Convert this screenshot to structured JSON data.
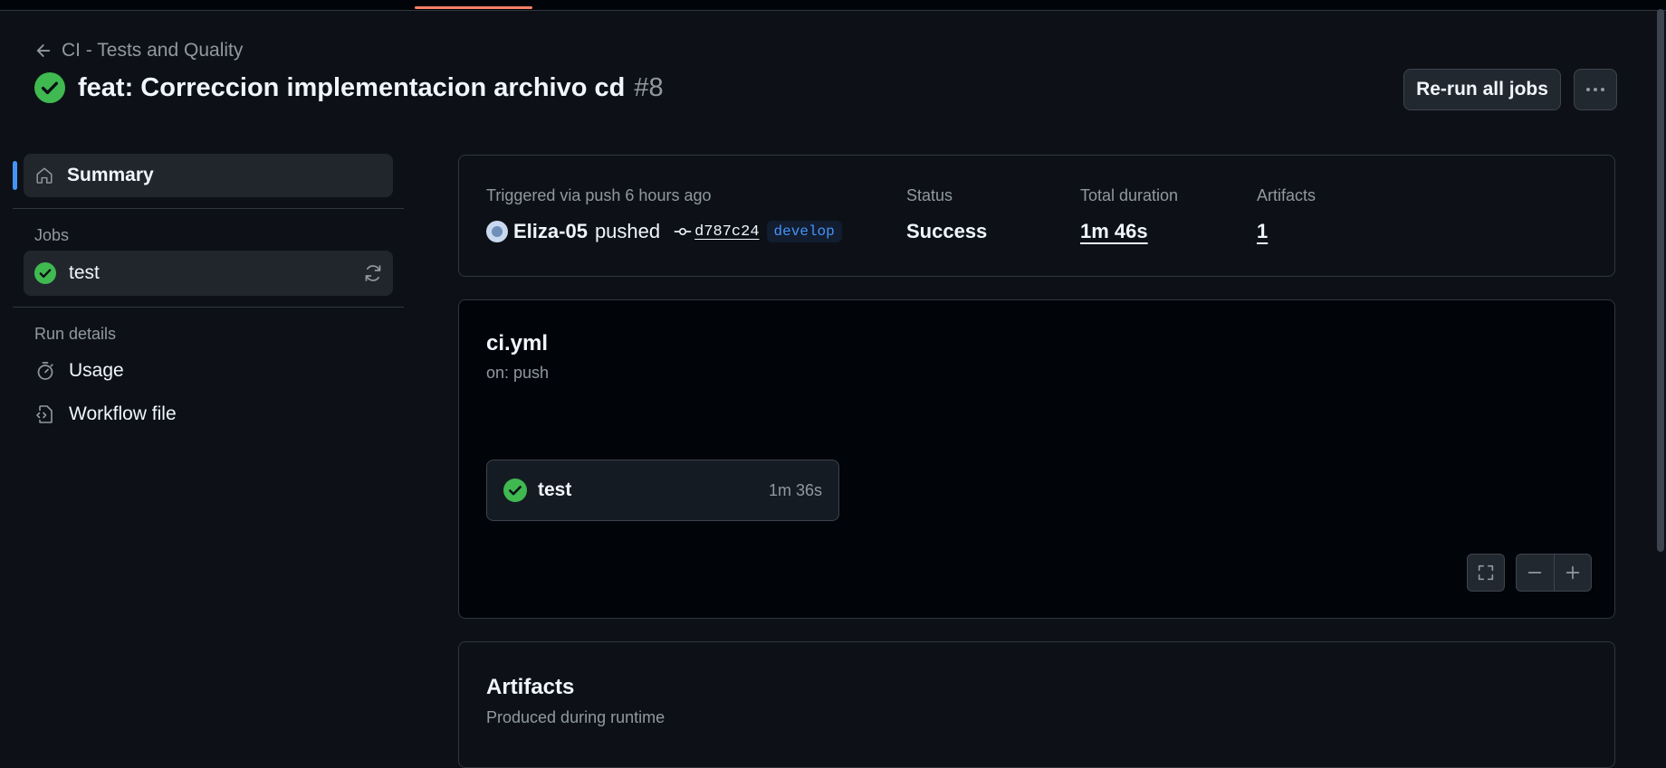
{
  "header": {
    "back_label": "CI - Tests and Quality",
    "title": "feat: Correccion implementacion archivo cd",
    "run_number": "#8",
    "rerun_label": "Re-run all jobs",
    "more_icon": "kebab-horizontal-icon"
  },
  "sidebar": {
    "summary_label": "Summary",
    "jobs_heading": "Jobs",
    "jobs": [
      {
        "label": "test",
        "status": "success"
      }
    ],
    "run_details_heading": "Run details",
    "run_details": [
      {
        "label": "Usage",
        "icon": "stopwatch-icon"
      },
      {
        "label": "Workflow file",
        "icon": "file-code-icon"
      }
    ]
  },
  "summary": {
    "trigger_text": "Triggered via push 6 hours ago",
    "actor": "Eliza-05",
    "action": "pushed",
    "commit_sha": "d787c24",
    "branch": "develop",
    "status_label": "Status",
    "status_value": "Success",
    "duration_label": "Total duration",
    "duration_value": "1m 46s",
    "artifacts_label": "Artifacts",
    "artifacts_value": "1"
  },
  "workflow": {
    "file_name": "ci.yml",
    "trigger": "on: push",
    "jobs": [
      {
        "name": "test",
        "duration": "1m 36s",
        "status": "success"
      }
    ]
  },
  "artifacts": {
    "title": "Artifacts",
    "subtitle": "Produced during runtime"
  },
  "colors": {
    "success": "#3fb950",
    "accent": "#4493f8",
    "background": "#0d1117",
    "tab_underline": "#f78166"
  }
}
